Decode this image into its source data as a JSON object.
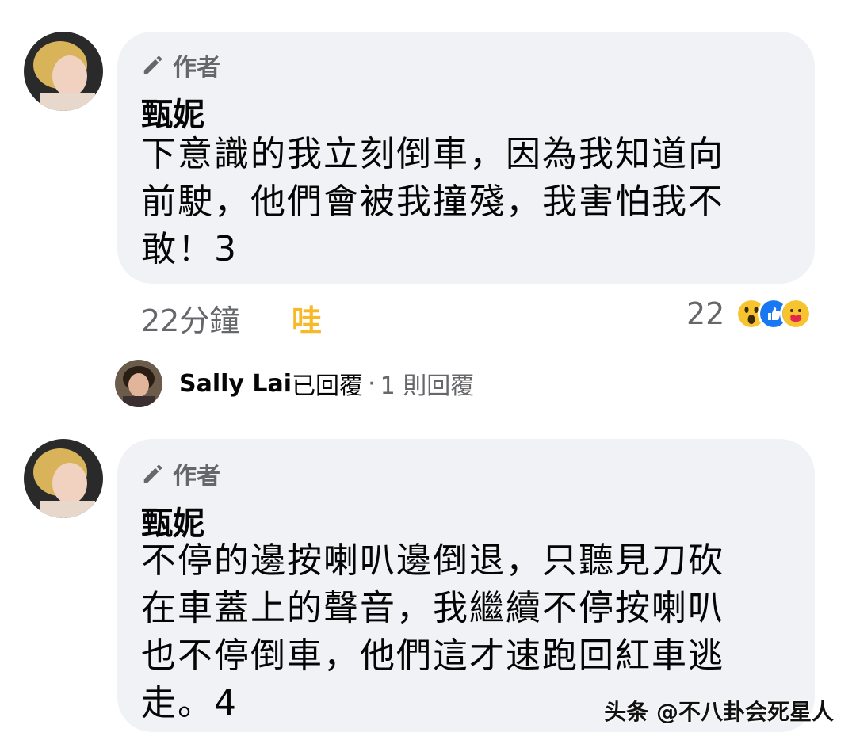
{
  "comments": [
    {
      "badge": "作者",
      "author": "甄妮",
      "lines": [
        "下意識的我立刻倒車，因為我知道向",
        "前駛，他們會被我撞殘，我害怕我不",
        "敢！3"
      ],
      "time": "22分鐘",
      "reaction_link": "哇",
      "reaction_count": "22",
      "reaction_icons": [
        "wow-icon",
        "like-icon",
        "care-icon"
      ]
    },
    {
      "badge": "作者",
      "author": "甄妮",
      "lines": [
        "不停的邊按喇叭邊倒退，只聽見刀砍",
        "在車蓋上的聲音，我繼續不停按喇叭",
        "也不停倒車，他們這才速跑回紅車逃",
        "走。4"
      ]
    }
  ],
  "reply_summary": {
    "name": "Sally Lai",
    "verb": "已回覆",
    "dot": "·",
    "count": "1 則回覆"
  },
  "watermark": "头条 @不八卦会死星人",
  "colors": {
    "bubble": "#f0f2f5",
    "secondary_text": "#65676b",
    "reaction_highlight": "#f7b928"
  }
}
